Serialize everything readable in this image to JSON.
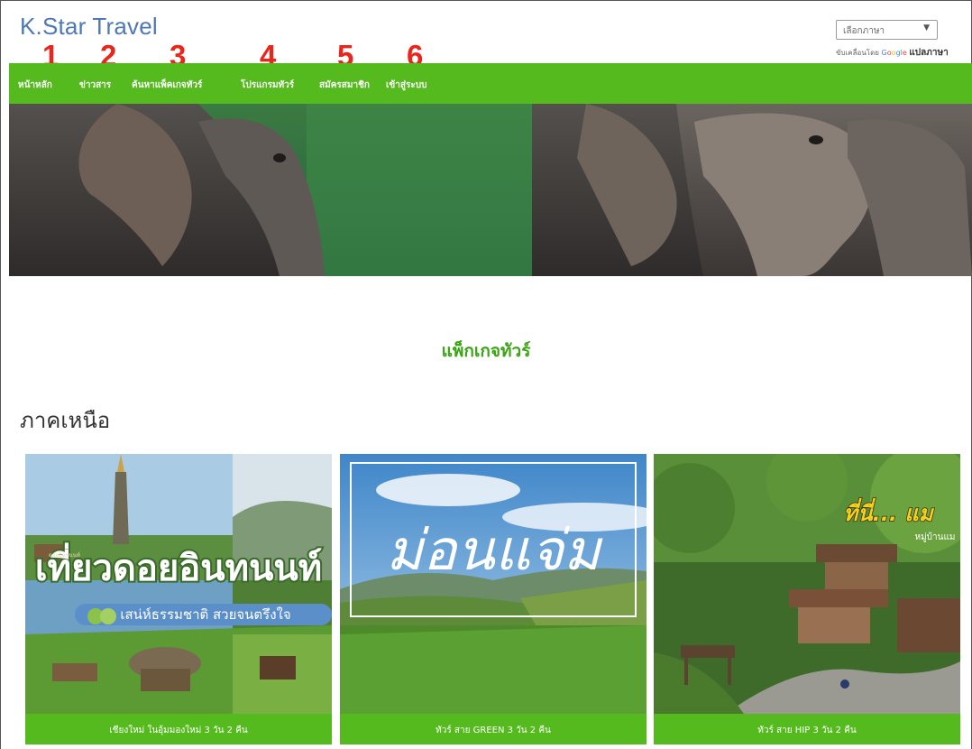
{
  "site": {
    "title": "K.Star Travel"
  },
  "language": {
    "select_label": "เลือกภาษา",
    "powered_prefix": "ขับเคลื่อนโดย",
    "google": [
      "G",
      "o",
      "o",
      "g",
      "l",
      "e"
    ],
    "translate_label": "แปลภาษา"
  },
  "annotations": [
    "1",
    "2",
    "3",
    "4",
    "5",
    "6"
  ],
  "nav": {
    "items": [
      {
        "label": "หน้าหลัก"
      },
      {
        "label": "ข่าวสาร"
      },
      {
        "label": "ค้นหาแพ็คเกจทัวร์"
      },
      {
        "label": "โปรแกรมทัวร์"
      },
      {
        "label": "สมัครสมาชิก"
      },
      {
        "label": "เข้าสู่ระบบ"
      }
    ],
    "color": "#55ba1d"
  },
  "main": {
    "heading": "แพ็กเกจทัวร์",
    "region": "ภาคเหนือ"
  },
  "cards": [
    {
      "caption": "เชียงใหม่ ในอุ้มมองใหม่ 3 วัน 2 คืน",
      "image_text_main": "เที่ยวดอยอินทนนท์",
      "image_text_sub": "เสน่ห์ธรรมชาติ สวยจนตรึงใจ",
      "image_sign": "ดอยอินทนนท์"
    },
    {
      "caption": "ทัวร์ สาย GREEN 3 วัน 2 คืน",
      "image_text_main": "ม่อนแจ่ม"
    },
    {
      "caption": "ทัวร์ สาย HIP 3 วัน 2 คืน",
      "image_text_main": "ที่นี่... แม",
      "image_text_sub": "หมู่บ้านแม"
    }
  ],
  "colors": {
    "accent": "#55ba1d",
    "title": "#4f79b5",
    "annotation": "#e8261c",
    "heading": "#3ca515"
  }
}
